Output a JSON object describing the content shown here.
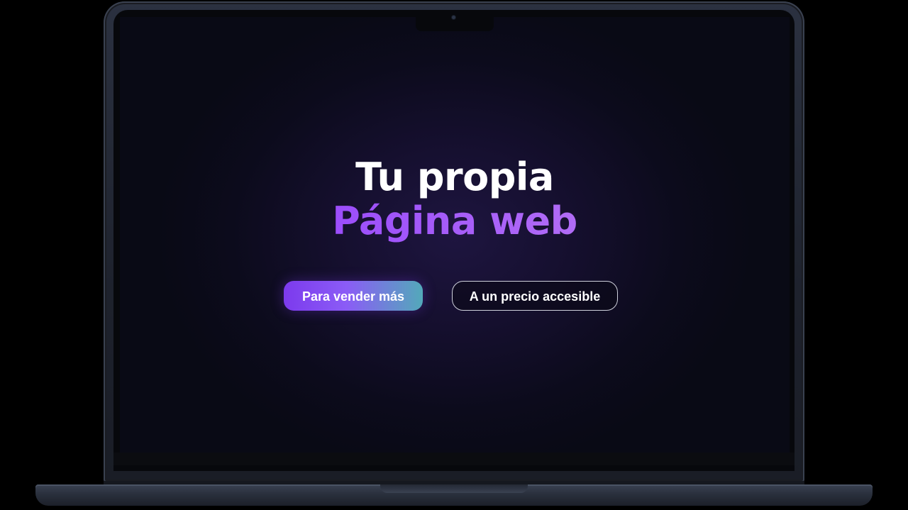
{
  "hero": {
    "title_line1": "Tu propia",
    "title_line2": "Página web",
    "primary_button": "Para vender más",
    "secondary_button": "A un precio accesible"
  },
  "colors": {
    "background": "#0c0b1c",
    "accent_purple": "#a855f7",
    "button_gradient_start": "#7c3aed",
    "button_gradient_end": "#34d399",
    "text": "#ffffff"
  }
}
